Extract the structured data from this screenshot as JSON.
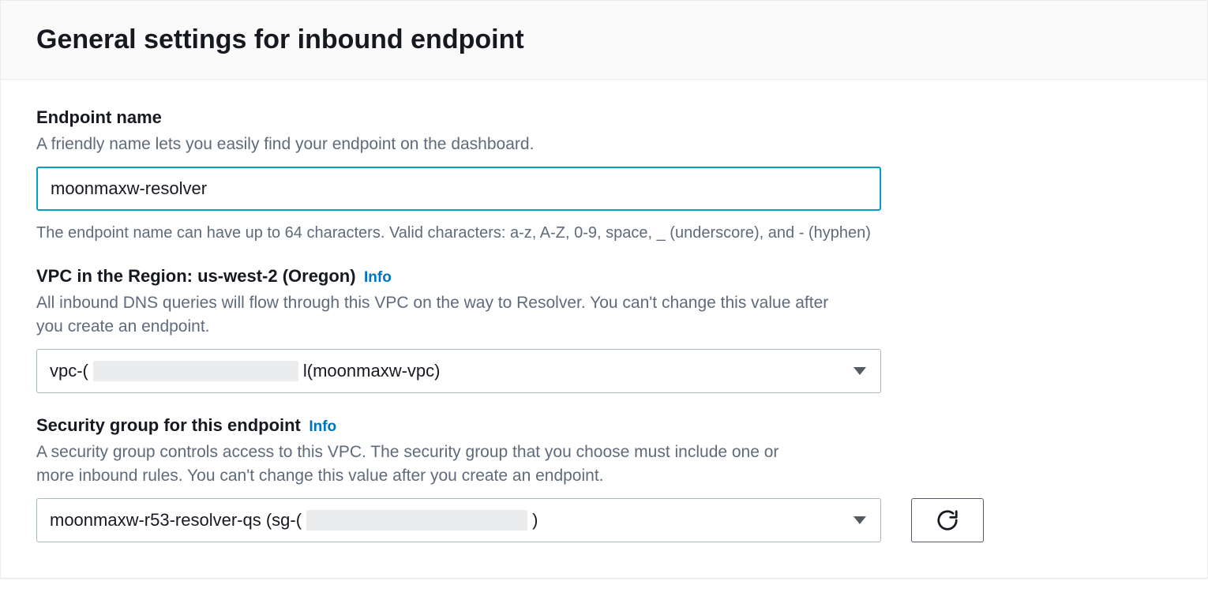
{
  "header": {
    "title": "General settings for inbound endpoint"
  },
  "endpoint_name": {
    "label": "Endpoint name",
    "description": "A friendly name lets you easily find your endpoint on the dashboard.",
    "value": "moonmaxw-resolver",
    "constraint": "The endpoint name can have up to 64 characters. Valid characters: a-z, A-Z, 0-9, space, _ (underscore), and - (hyphen)"
  },
  "vpc": {
    "label": "VPC in the Region: us-west-2 (Oregon)",
    "info": "Info",
    "description": "All inbound DNS queries will flow through this VPC on the way to Resolver. You can't change this value after you create an endpoint.",
    "value_prefix": "vpc-(",
    "value_mid": "l",
    "value_suffix": " (moonmaxw-vpc)"
  },
  "security_group": {
    "label": "Security group for this endpoint",
    "info": "Info",
    "description": "A security group controls access to this VPC. The security group that you choose must include one or more inbound rules. You can't change this value after you create an endpoint.",
    "value_prefix": "moonmaxw-r53-resolver-qs (sg-(",
    "value_suffix": ")"
  }
}
